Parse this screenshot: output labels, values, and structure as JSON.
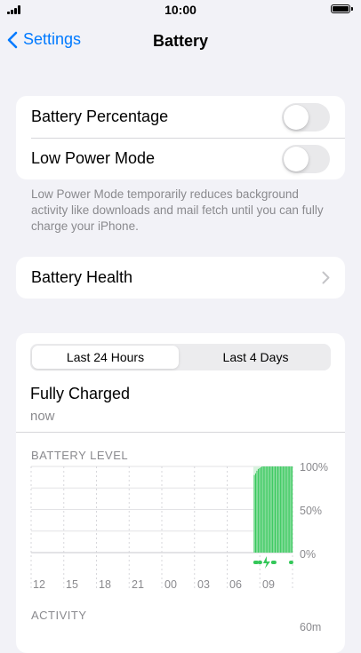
{
  "status_bar": {
    "time": "10:00"
  },
  "nav": {
    "back_label": "Settings",
    "title": "Battery"
  },
  "settings": {
    "battery_percentage": {
      "label": "Battery Percentage",
      "enabled": false
    },
    "low_power_mode": {
      "label": "Low Power Mode",
      "enabled": false
    },
    "footnote": "Low Power Mode temporarily reduces background activity like downloads and mail fetch until you can fully charge your iPhone.",
    "battery_health_label": "Battery Health"
  },
  "usage": {
    "tabs": [
      {
        "label": "Last 24 Hours",
        "selected": true
      },
      {
        "label": "Last 4 Days",
        "selected": false
      }
    ],
    "last_charge_title": "Fully Charged",
    "last_charge_time": "now",
    "battery_level_label": "BATTERY LEVEL",
    "activity_label": "ACTIVITY",
    "activity_y_top": "60m"
  },
  "chart_data": {
    "type": "bar",
    "title": "BATTERY LEVEL",
    "y_tick_labels": [
      "100%",
      "50%",
      "0%"
    ],
    "ylim": [
      0,
      100
    ],
    "x_tick_labels": [
      "12",
      "15",
      "18",
      "21",
      "00",
      "03",
      "06",
      "09"
    ],
    "bar_color": "#34c759",
    "charging_color": "#34c759",
    "values": [
      90,
      92,
      95,
      97,
      98,
      99,
      100,
      100,
      100,
      100,
      100,
      100,
      100,
      100,
      100,
      100,
      100,
      100,
      100,
      100,
      100,
      100,
      100,
      100,
      100,
      100,
      100,
      100,
      100,
      100
    ]
  }
}
